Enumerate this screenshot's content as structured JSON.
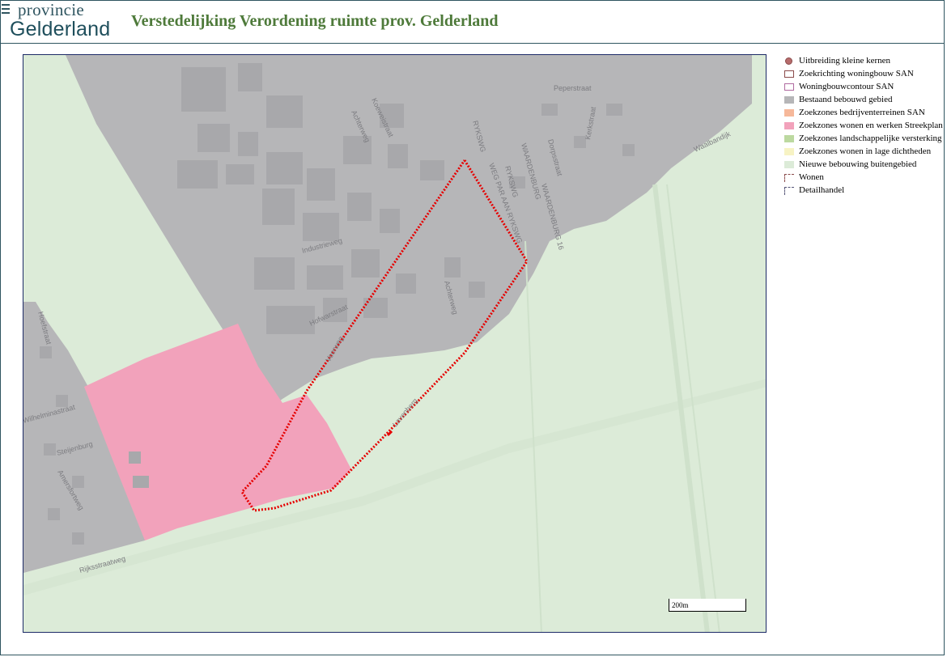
{
  "header": {
    "logo_top": "provincie",
    "logo_bottom": "Gelderland",
    "title": "Verstedelijking Verordening ruimte prov. Gelderland"
  },
  "map": {
    "street_labels": [
      "Koeweistraat",
      "Achterweg",
      "Peperstraat",
      "Kerkstraat",
      "RYKSWG",
      "WAARDENBURG",
      "RYKSWG",
      "WEG PAR AAN RYKSWG",
      "Dorpsstraat",
      "WAARDENBURG 16",
      "Industrieweg",
      "Achterweg",
      "Hofwarstraat",
      "Veerweg",
      "Hoefstraat",
      "Wilhelminastraat",
      "Steijenburg",
      "Amersfortweg",
      "Rijksstraatweg",
      "Waalbandijk",
      "Lavenberg"
    ],
    "scale_label": "200m",
    "colors": {
      "existing_built": "#b6b6b8",
      "new_built_outside": "#dcebd8",
      "zoekzones_wonen_werken": "#f2a2bb",
      "plan_outline": "#e60000"
    }
  },
  "legend": {
    "items": [
      {
        "label": "Uitbreiding kleine kernen",
        "icon": "dot-icon",
        "color": "#b76c6c"
      },
      {
        "label": "Zoekrichting woningbouw SAN",
        "icon": "outline-swatch",
        "color": "#8a4a4a"
      },
      {
        "label": "Woningbouwcontour SAN",
        "icon": "outline-swatch",
        "color": "#b06aa0"
      },
      {
        "label": "Bestaand bebouwd gebied",
        "icon": "fill-swatch",
        "color": "#b6b6b8"
      },
      {
        "label": "Zoekzones bedrijventerreinen SAN",
        "icon": "fill-swatch",
        "color": "#f6b89a"
      },
      {
        "label": "Zoekzones wonen en werken Streekplan",
        "icon": "fill-swatch",
        "color": "#f2a2bb"
      },
      {
        "label": "Zoekzones landschappelijke versterking",
        "icon": "fill-swatch",
        "color": "#bcd9a0"
      },
      {
        "label": "Zoekzones wonen in lage dichtheden",
        "icon": "fill-swatch",
        "color": "#f7f3c4"
      },
      {
        "label": "Nieuwe bebouwing buitengebied",
        "icon": "fill-swatch",
        "color": "#dcebd8"
      },
      {
        "label": "Wonen",
        "icon": "dashed-swatch",
        "color": "#8a4a4a"
      },
      {
        "label": "Detailhandel",
        "icon": "dashed-swatch",
        "color": "#555577"
      }
    ]
  }
}
